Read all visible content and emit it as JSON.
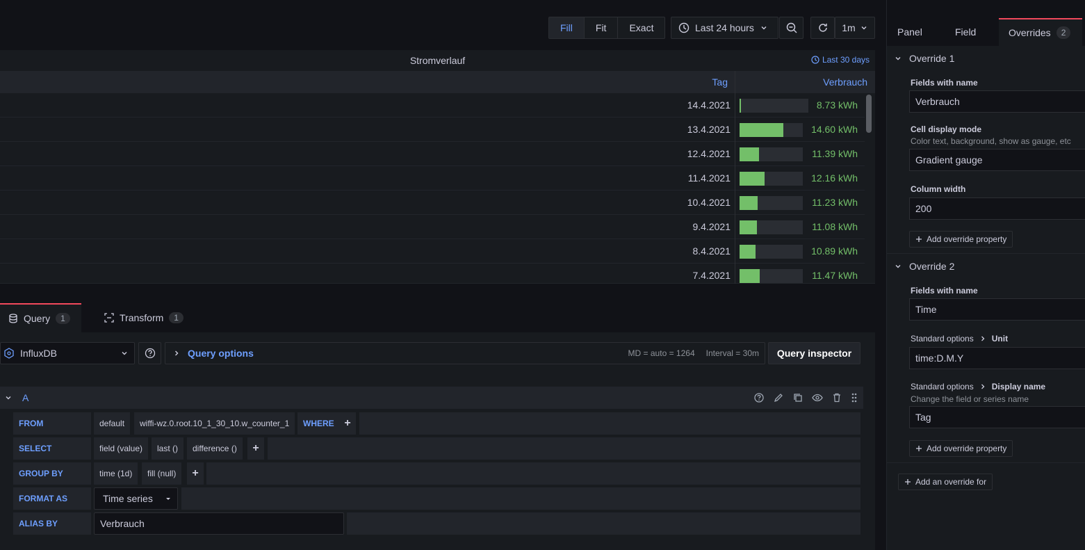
{
  "toolbar": {
    "view_modes": [
      "Fill",
      "Fit",
      "Exact"
    ],
    "active_view": "Fill",
    "time_range": "Last 24 hours",
    "refresh_interval": "1m"
  },
  "panel": {
    "title": "Stromverlauf",
    "time_info": "Last 30 days",
    "columns": [
      "Tag",
      "Verbrauch"
    ],
    "rows": [
      {
        "date": "14.4.2021",
        "value": "8.73 kWh",
        "level": 0.02
      },
      {
        "date": "13.4.2021",
        "value": "14.60 kWh",
        "level": 0.69
      },
      {
        "date": "12.4.2021",
        "value": "11.39 kWh",
        "level": 0.31
      },
      {
        "date": "11.4.2021",
        "value": "12.16 kWh",
        "level": 0.4
      },
      {
        "date": "10.4.2021",
        "value": "11.23 kWh",
        "level": 0.29
      },
      {
        "date": "9.4.2021",
        "value": "11.08 kWh",
        "level": 0.27
      },
      {
        "date": "8.4.2021",
        "value": "10.89 kWh",
        "level": 0.25
      },
      {
        "date": "7.4.2021",
        "value": "11.47 kWh",
        "level": 0.32
      }
    ]
  },
  "query_tabs": [
    {
      "label": "Query",
      "count": "1"
    },
    {
      "label": "Transform",
      "count": "1"
    }
  ],
  "datasource": {
    "name": "InfluxDB",
    "options_label": "Query options",
    "md_info": "MD = auto = 1264",
    "interval_info": "Interval = 30m",
    "inspector_label": "Query inspector"
  },
  "query": {
    "ref": "A",
    "from_label": "FROM",
    "from_policy": "default",
    "from_measurement": "wiffi-wz.0.root.10_1_30_10.w_counter_1",
    "where_label": "WHERE",
    "select_label": "SELECT",
    "select_parts": [
      "field (value)",
      "last ()",
      "difference ()"
    ],
    "group_label": "GROUP BY",
    "group_parts": [
      "time (1d)",
      "fill (null)"
    ],
    "format_label": "FORMAT AS",
    "format_value": "Time series",
    "alias_label": "ALIAS BY",
    "alias_value": "Verbrauch"
  },
  "right_pane": {
    "tabs": [
      "Panel",
      "Field",
      "Overrides"
    ],
    "overrides_count": "2",
    "override1": {
      "title": "Override 1",
      "fields_label": "Fields with name",
      "fields_value": "Verbrauch",
      "cell_mode_label": "Cell display mode",
      "cell_mode_desc": "Color text, background, show as gauge, etc",
      "cell_mode_value": "Gradient gauge",
      "col_width_label": "Column width",
      "col_width_value": "200",
      "add_property": "Add override property"
    },
    "override2": {
      "title": "Override 2",
      "fields_label": "Fields with name",
      "fields_value": "Time",
      "unit_path_a": "Standard options",
      "unit_path_b": "Unit",
      "unit_value": "time:D.M.Y",
      "dn_path_a": "Standard options",
      "dn_path_b": "Display name",
      "dn_desc": "Change the field or series name",
      "dn_value": "Tag",
      "add_property": "Add override property"
    },
    "add_override": "Add an override for"
  }
}
